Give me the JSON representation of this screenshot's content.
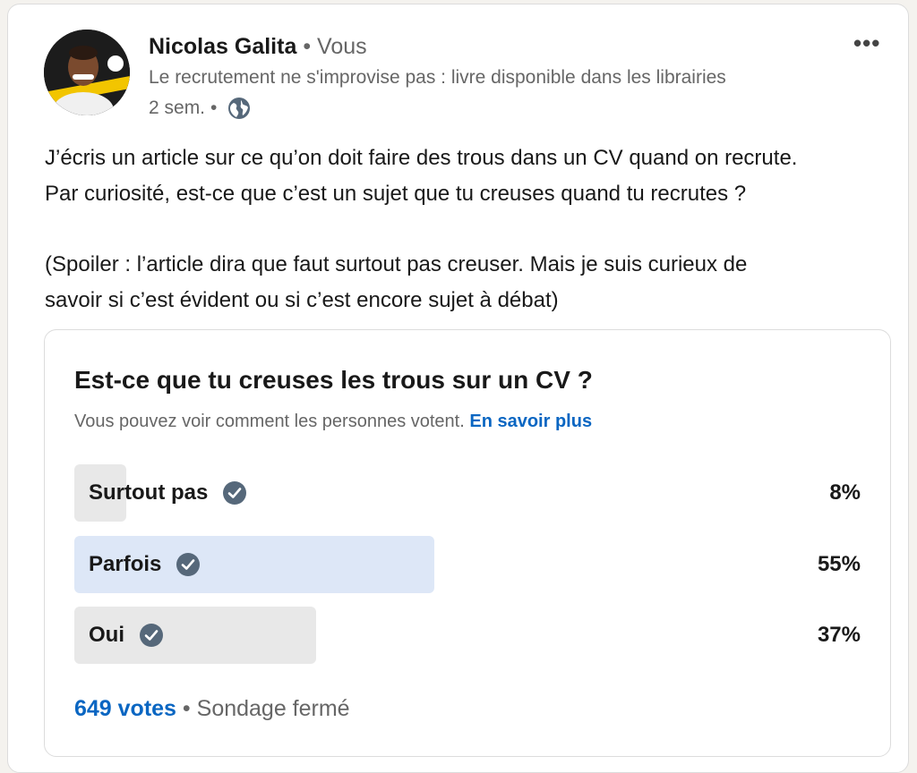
{
  "post": {
    "author": {
      "name": "Nicolas Galita",
      "separator": "•",
      "relation": "Vous",
      "headline": "Le recrutement ne s'improvise pas : livre disponible dans les librairies",
      "time": "2 sem.",
      "time_sep": "•",
      "visibility_icon": "globe-icon",
      "avatar_icon": "avatar-photo"
    },
    "more_label": "•••",
    "text": {
      "line1": "J’écris un article sur ce qu’on doit faire des trous dans un CV quand on recrute.",
      "line2": "Par curiosité, est-ce que c’est un sujet que tu creuses quand tu recrutes ?",
      "line3": "(Spoiler : l’article dira que faut surtout pas creuser. Mais je suis curieux de",
      "line4": "savoir si c’est évident ou si c’est encore sujet à débat)"
    }
  },
  "poll": {
    "question": "Est-ce que tu creuses les trous sur un CV ?",
    "info": "Vous pouvez voir comment les personnes votent.",
    "learn_more": "En savoir plus",
    "options": [
      {
        "label": "Surtout pas",
        "percent_label": "8%",
        "fraction": 0.08,
        "selected": false,
        "color": "#e8e8e8"
      },
      {
        "label": "Parfois",
        "percent_label": "55%",
        "fraction": 0.55,
        "selected": true,
        "color": "#dde7f7"
      },
      {
        "label": "Oui",
        "percent_label": "37%",
        "fraction": 0.37,
        "selected": false,
        "color": "#e8e8e8"
      }
    ],
    "votes": "649 votes",
    "status_sep": "•",
    "status": "Sondage fermé"
  },
  "colors": {
    "link": "#0a66c2",
    "check": "#56687a",
    "muted_text": "#666666"
  }
}
